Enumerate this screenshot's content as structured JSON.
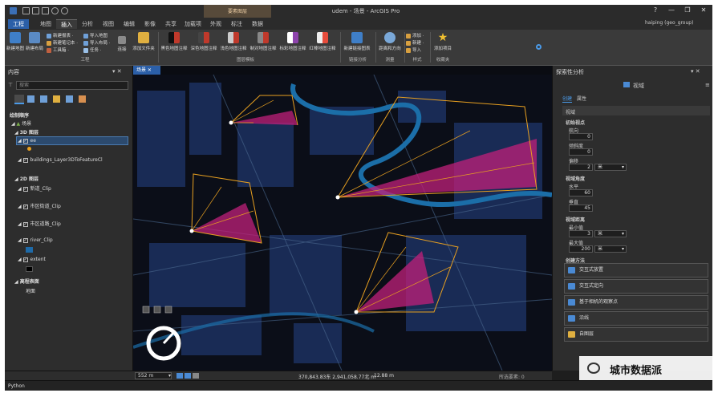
{
  "window": {
    "title": "udem - 场景 - ArcGIS Pro",
    "context_tab_group": "要素图层",
    "user": "haiping (geo_group)",
    "controls": [
      "?",
      "—",
      "❐",
      "✕"
    ]
  },
  "ribbon_tabs": [
    "工程",
    "地图",
    "插入",
    "分析",
    "视图",
    "编辑",
    "影像",
    "共享",
    "加载项",
    "外观",
    "标注",
    "数据"
  ],
  "ribbon": {
    "project_group": {
      "label": "工程",
      "big": [
        "新建地图",
        "新建布局"
      ],
      "small": [
        "新建报表 ·",
        "新建笔记本 ·",
        "工具箱 ·",
        "导入地图",
        "导入布局 ·",
        "任务 ·"
      ],
      "connect": "连接",
      "add_folder": "添加文件夹"
    },
    "layer_templates": {
      "label": "图层模板",
      "items": [
        "黑色地图注释",
        "深色地图注释",
        "浅色地图注释",
        "制对地图注释",
        "标彩地图注释",
        "红棒地图注释"
      ]
    },
    "link_analysis": {
      "label": "链接分析",
      "items": [
        "新建链接图表"
      ]
    },
    "measure": {
      "label": "测量",
      "items": [
        "距离和方向"
      ]
    },
    "styles": {
      "label": "样式",
      "items": [
        "添加 ·",
        "新建 ·",
        "导入"
      ]
    },
    "favorites": {
      "label": "收藏夹",
      "items": [
        "添加项目"
      ]
    }
  },
  "contents": {
    "title": "内容",
    "search_placeholder": "搜索",
    "draw_order": "绘制顺序",
    "scene": "场景",
    "layers_3d": "3D 图层",
    "items_3d": [
      "ee",
      "buildings_Layer3DToFeatureCl"
    ],
    "layers_2d": "2D 图层",
    "items_2d": [
      "新道_Clip",
      "市区街道_Clip",
      "市区道路_Clip",
      "river_Clip",
      "extent"
    ],
    "elevation": "高程表面",
    "ground": "地面"
  },
  "map": {
    "tab": "场景",
    "scale": "552 m",
    "coords": "370,843.83东 2,941,058.77北 m",
    "elevation": "12.88 m",
    "selected": "所选要素: 0"
  },
  "exploratory": {
    "title": "探索性分析",
    "tool": "视域",
    "tabs": [
      "创建",
      "属性"
    ],
    "section": "视域",
    "obs_header": "初始视点",
    "heading_label": "航向",
    "heading_value": "0",
    "tilt_label": "倾斜度",
    "tilt_value": "0",
    "offset_label": "偏移",
    "offset_value": "2",
    "offset_unit": "米",
    "angle_header": "视域角度",
    "horiz_label": "水平",
    "horiz_value": "60",
    "vert_label": "垂直",
    "vert_value": "45",
    "dist_header": "视域距离",
    "min_label": "最小值",
    "min_value": "3",
    "min_unit": "米",
    "max_label": "最大值",
    "max_value": "200",
    "max_unit": "米",
    "method_header": "创建方法",
    "methods": [
      "交互式放置",
      "交互式定向",
      "基于相机的观察点",
      "沿线",
      "自图层"
    ]
  },
  "bottom": {
    "python_tab": "Python"
  },
  "watermark_text": "城市数据派"
}
